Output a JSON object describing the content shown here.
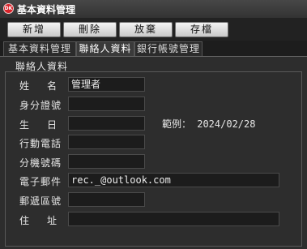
{
  "window": {
    "title": "基本資料管理",
    "icon_label": "DK"
  },
  "toolbar": {
    "new": "新增",
    "delete": "刪除",
    "abandon": "放棄",
    "save": "存檔"
  },
  "tabs": [
    "基本資料管理",
    "聯絡人資料",
    "銀行帳號管理"
  ],
  "group": {
    "title": "聯絡人資料"
  },
  "form": {
    "name_label": "姓名",
    "name_value": "管理者",
    "id_label": "身分證號",
    "id_value": "",
    "birthday_label": "生日",
    "birthday_value": "",
    "birthday_hint": "範例： 2024/02/28",
    "mobile_label": "行動電話",
    "mobile_value": "",
    "ext_label": "分機號碼",
    "ext_value": "",
    "email_label": "電子郵件",
    "email_value": "rec._@outlook.com",
    "zip_label": "郵遞區號",
    "zip_value": "",
    "address_label": "住址",
    "address_value": ""
  }
}
